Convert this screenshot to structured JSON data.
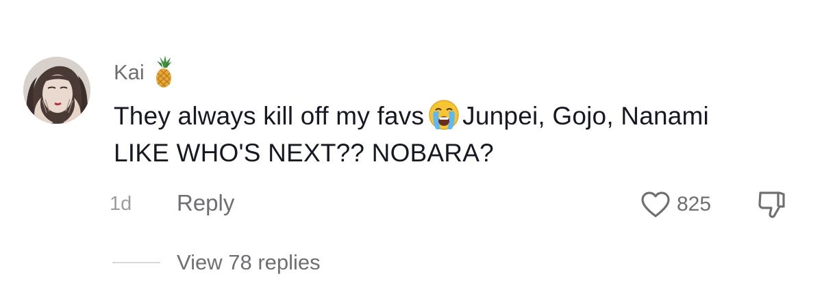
{
  "comment": {
    "username": "Kai",
    "username_emoji": "pineapple-emoji",
    "text_part1": "They always kill off my favs",
    "text_emoji": "loudly-crying-face-emoji",
    "text_part2": "Junpei, Gojo, Nanami LIKE WHO'S NEXT?? NOBARA?",
    "timestamp": "1d",
    "reply_label": "Reply",
    "like_count": "825",
    "view_replies_label": "View 78 replies"
  },
  "colors": {
    "primary_text": "#161823",
    "secondary_text": "#6f6f73",
    "muted_text": "#9c9c9f"
  }
}
